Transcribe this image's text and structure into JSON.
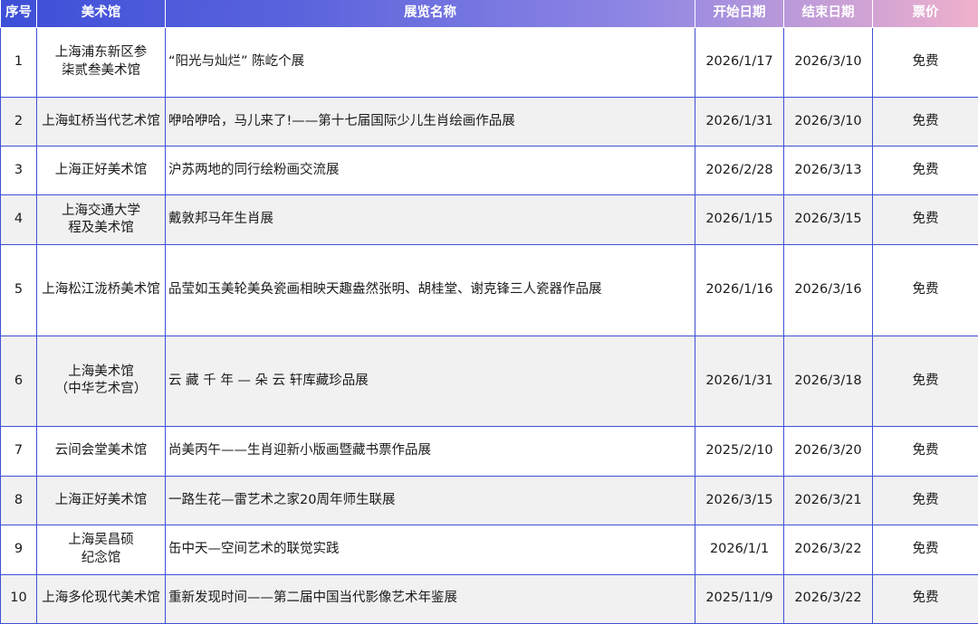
{
  "header": {
    "no": "序号",
    "museum": "美术馆",
    "name": "展览名称",
    "start": "开始日期",
    "end": "结束日期",
    "price": "票价"
  },
  "rows": [
    {
      "no": "1",
      "museum": "上海浦东新区参\n柒贰叁美术馆",
      "name": "“阳光与灿烂” 陈屹个展",
      "start": "2026/1/17",
      "end": "2026/3/10",
      "price": "免费"
    },
    {
      "no": "2",
      "museum": "上海虹桥当代艺术馆",
      "name": "咿哈咿哈，马儿来了!——第十七届国际少儿生肖绘画作品展",
      "start": "2026/1/31",
      "end": "2026/3/10",
      "price": "免费"
    },
    {
      "no": "3",
      "museum": "上海正好美术馆",
      "name": "沪苏两地的同行绘粉画交流展",
      "start": "2026/2/28",
      "end": "2026/3/13",
      "price": "免费"
    },
    {
      "no": "4",
      "museum": "上海交通大学\n程及美术馆",
      "name": "戴敦邦马年生肖展",
      "start": "2026/1/15",
      "end": "2026/3/15",
      "price": "免费"
    },
    {
      "no": "5",
      "museum": "上海松江泷桥美术馆",
      "name": "品莹如玉美轮美奂瓷画相映天趣盎然张明、胡桂堂、谢克锋三人瓷器作品展",
      "start": "2026/1/16",
      "end": "2026/3/16",
      "price": "免费"
    },
    {
      "no": "6",
      "museum": "上海美术馆\n（中华艺术宫）",
      "name": "云 藏 千 年 — 朵 云 轩库藏珍品展",
      "start": "2026/1/31",
      "end": "2026/3/18",
      "price": "免费"
    },
    {
      "no": "7",
      "museum": "云间会堂美术馆",
      "name": "尚美丙午——生肖迎新小版画暨藏书票作品展",
      "start": "2025/2/10",
      "end": "2026/3/20",
      "price": "免费"
    },
    {
      "no": "8",
      "museum": "上海正好美术馆",
      "name": "一路生花—雷艺术之家20周年师生联展",
      "start": "2026/3/15",
      "end": "2026/3/21",
      "price": "免费"
    },
    {
      "no": "9",
      "museum": "上海吴昌硕\n纪念馆",
      "name": "缶中天—空间艺术的联觉实践",
      "start": "2026/1/1",
      "end": "2026/3/22",
      "price": "免费"
    },
    {
      "no": "10",
      "museum": "上海多伦现代美术馆",
      "name": "重新发现时间——第二届中国当代影像艺术年鉴展",
      "start": "2025/11/9",
      "end": "2026/3/22",
      "price": "免费"
    }
  ],
  "colors": {
    "border": "#3f4fd6",
    "header_start": "#3d4fd8",
    "header_end": "#f0b1cc",
    "row_alt": "#f1f1f1"
  }
}
